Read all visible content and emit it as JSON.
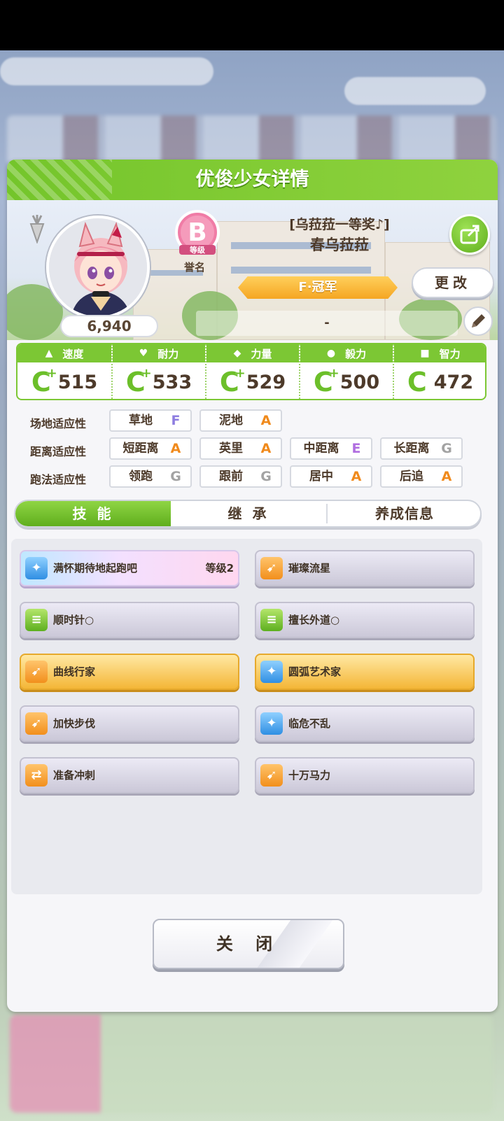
{
  "panel": {
    "title": "优俊少女详情"
  },
  "profile": {
    "score": "6,940",
    "rank_letter": "B",
    "rank_small": "等级",
    "rank_label": "誉名",
    "title": "[乌菈菈一等奖♪]",
    "name": "春乌菈菈",
    "champion": "F·冠军",
    "change_label": "更改",
    "subtitle": "-"
  },
  "stats": [
    {
      "label": "速度",
      "icon": "shoe-icon",
      "glyph": "▲",
      "grade": "C",
      "plus": true,
      "value": "515"
    },
    {
      "label": "耐力",
      "icon": "heart-icon",
      "glyph": "♥",
      "grade": "C",
      "plus": true,
      "value": "533"
    },
    {
      "label": "力量",
      "icon": "arm-icon",
      "glyph": "◆",
      "grade": "C",
      "plus": true,
      "value": "529"
    },
    {
      "label": "毅力",
      "icon": "flame-icon",
      "glyph": "●",
      "grade": "C",
      "plus": true,
      "value": "500"
    },
    {
      "label": "智力",
      "icon": "graduation-cap-icon",
      "glyph": "■",
      "grade": "C",
      "plus": false,
      "value": "472"
    }
  ],
  "aptitude": {
    "track_label": "场地适应性",
    "distance_label": "距离适应性",
    "style_label": "跑法适应性",
    "track": [
      {
        "name": "草地",
        "grade": "F"
      },
      {
        "name": "泥地",
        "grade": "A"
      }
    ],
    "distance": [
      {
        "name": "短距离",
        "grade": "A"
      },
      {
        "name": "英里",
        "grade": "A"
      },
      {
        "name": "中距离",
        "grade": "E"
      },
      {
        "name": "长距离",
        "grade": "G"
      }
    ],
    "style": [
      {
        "name": "领跑",
        "grade": "G"
      },
      {
        "name": "跟前",
        "grade": "G"
      },
      {
        "name": "居中",
        "grade": "A"
      },
      {
        "name": "后追",
        "grade": "A"
      }
    ]
  },
  "tabs": [
    "技 能",
    "继 承",
    "养成信息"
  ],
  "skills": [
    {
      "name": "满怀期待地起跑吧",
      "level": "等级2",
      "style": "rainbow",
      "icon": "sparkle-icon",
      "icon_color": "blue"
    },
    {
      "name": "璀璨流星",
      "level": "",
      "style": "normal",
      "icon": "runner-icon",
      "icon_color": "orange"
    },
    {
      "name": "顺时针○",
      "level": "",
      "style": "normal",
      "icon": "course-icon",
      "icon_color": "green"
    },
    {
      "name": "擅长外道○",
      "level": "",
      "style": "normal",
      "icon": "course-icon",
      "icon_color": "green"
    },
    {
      "name": "曲线行家",
      "level": "",
      "style": "gold",
      "icon": "runner-icon",
      "icon_color": "orange"
    },
    {
      "name": "圆弧艺术家",
      "level": "",
      "style": "gold",
      "icon": "sparkle-icon",
      "icon_color": "blue"
    },
    {
      "name": "加快步伐",
      "level": "",
      "style": "normal",
      "icon": "runner-icon",
      "icon_color": "orange"
    },
    {
      "name": "临危不乱",
      "level": "",
      "style": "normal",
      "icon": "sparkle-icon",
      "icon_color": "blue"
    },
    {
      "name": "准备冲刺",
      "level": "",
      "style": "normal",
      "icon": "arrows-icon",
      "icon_color": "orange"
    },
    {
      "name": "十万马力",
      "level": "",
      "style": "normal",
      "icon": "runner-icon",
      "icon_color": "orange"
    }
  ],
  "close_label": "关 闭",
  "colors": {
    "accent_green": "#7cc734",
    "gold": "#f4b637",
    "brown_text": "#4d3a2a"
  }
}
